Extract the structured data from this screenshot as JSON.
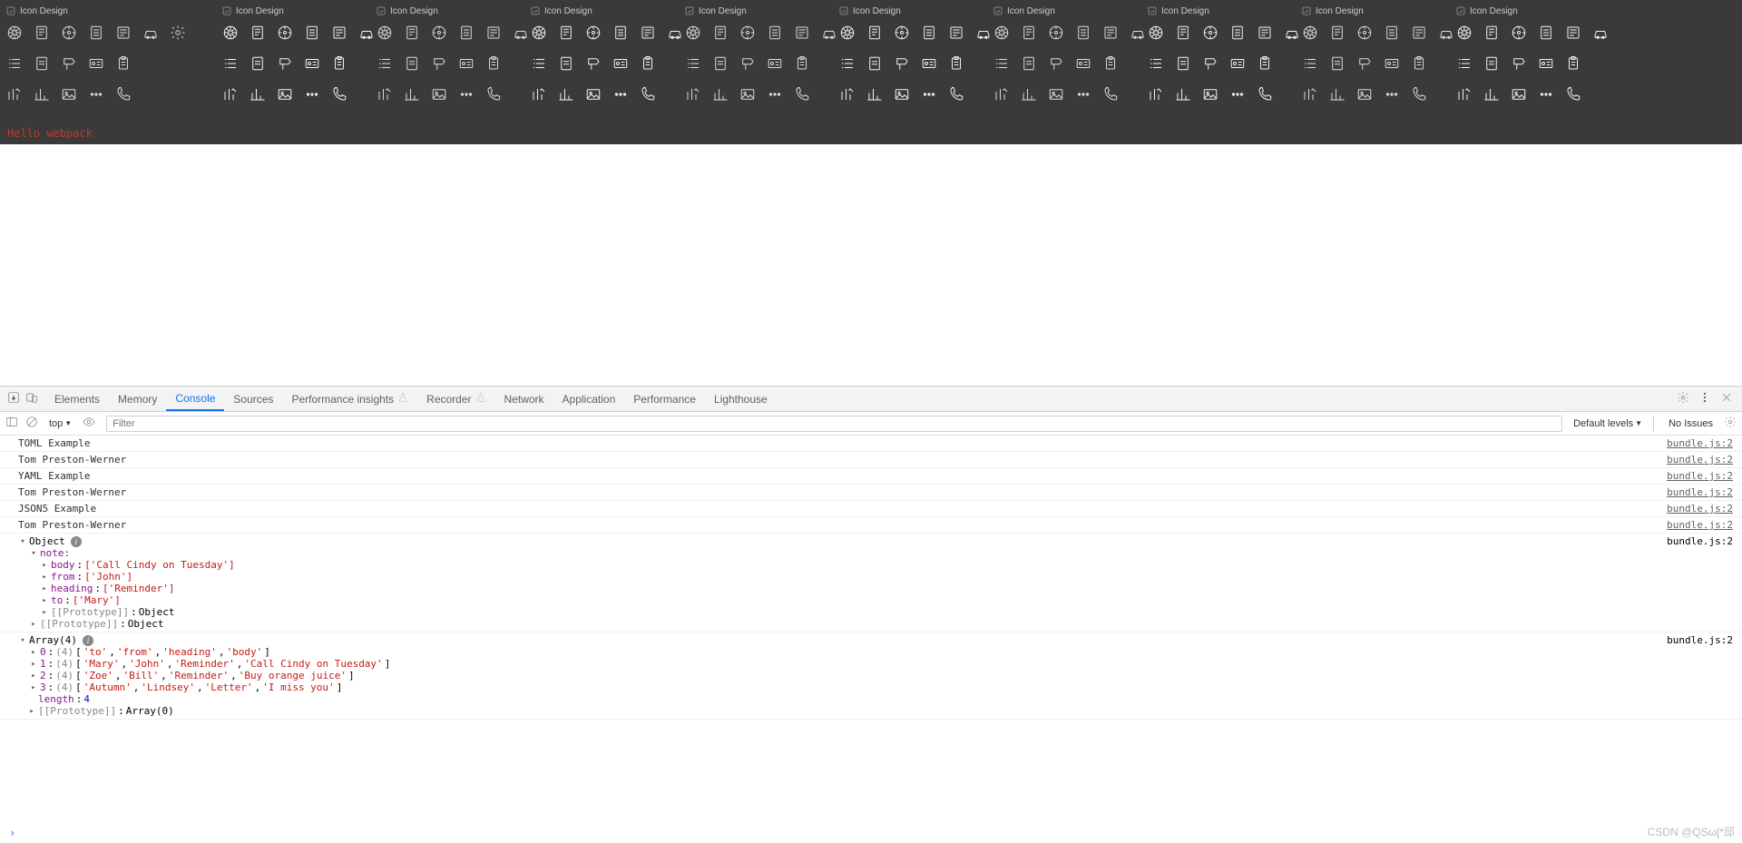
{
  "top": {
    "group_label": "Icon Design",
    "icons_row1": [
      "wheel-icon",
      "document-icon",
      "wheel-alt-icon",
      "document-lines-icon",
      "note-icon",
      "car-icon",
      "gear-icon"
    ],
    "icons_row2": [
      "list-icon",
      "doc-lines-icon",
      "sign-icon",
      "id-card-icon",
      "clipboard-icon"
    ],
    "icons_row3": [
      "chart-arrow-icon",
      "bar-chart-icon",
      "image-icon",
      "dots-icon",
      "phone-icon"
    ]
  },
  "hello_text": "Hello webpack",
  "devtools": {
    "tabs": [
      "Elements",
      "Memory",
      "Console",
      "Sources",
      "Performance insights",
      "Recorder",
      "Network",
      "Application",
      "Performance",
      "Lighthouse"
    ],
    "active_tab_index": 2,
    "context": "top",
    "filter_placeholder": "Filter",
    "levels_label": "Default levels",
    "issues_label": "No Issues",
    "src_link": "bundle.js:2",
    "rows": [
      "TOML Example",
      "Tom Preston-Werner",
      "YAML Example",
      "Tom Preston-Werner",
      "JSON5 Example",
      "Tom Preston-Werner"
    ],
    "object_block": {
      "header": "Object",
      "note_label": "note:",
      "entries": [
        {
          "k": "body",
          "v": "['Call Cindy on Tuesday']"
        },
        {
          "k": "from",
          "v": "['John']"
        },
        {
          "k": "heading",
          "v": "['Reminder']"
        },
        {
          "k": "to",
          "v": "['Mary']"
        },
        {
          "k": "[[Prototype]]",
          "v": "Object",
          "proto": true
        }
      ],
      "proto_outer": {
        "k": "[[Prototype]]",
        "v": "Object"
      }
    },
    "array_block": {
      "header": "Array(4)",
      "lines": [
        {
          "idx": "0",
          "len": "(4)",
          "items": [
            "'to'",
            "'from'",
            "'heading'",
            "'body'"
          ]
        },
        {
          "idx": "1",
          "len": "(4)",
          "items": [
            "'Mary'",
            "'John'",
            "'Reminder'",
            "'Call Cindy on Tuesday'"
          ]
        },
        {
          "idx": "2",
          "len": "(4)",
          "items": [
            "'Zoe'",
            "'Bill'",
            "'Reminder'",
            "'Buy orange juice'"
          ]
        },
        {
          "idx": "3",
          "len": "(4)",
          "items": [
            "'Autumn'",
            "'Lindsey'",
            "'Letter'",
            "'I miss you'"
          ]
        }
      ],
      "length_label": "length",
      "length_value": "4",
      "proto": {
        "k": "[[Prototype]]",
        "v": "Array(0)"
      }
    }
  },
  "watermark": "CSDN @QSω[*邱"
}
